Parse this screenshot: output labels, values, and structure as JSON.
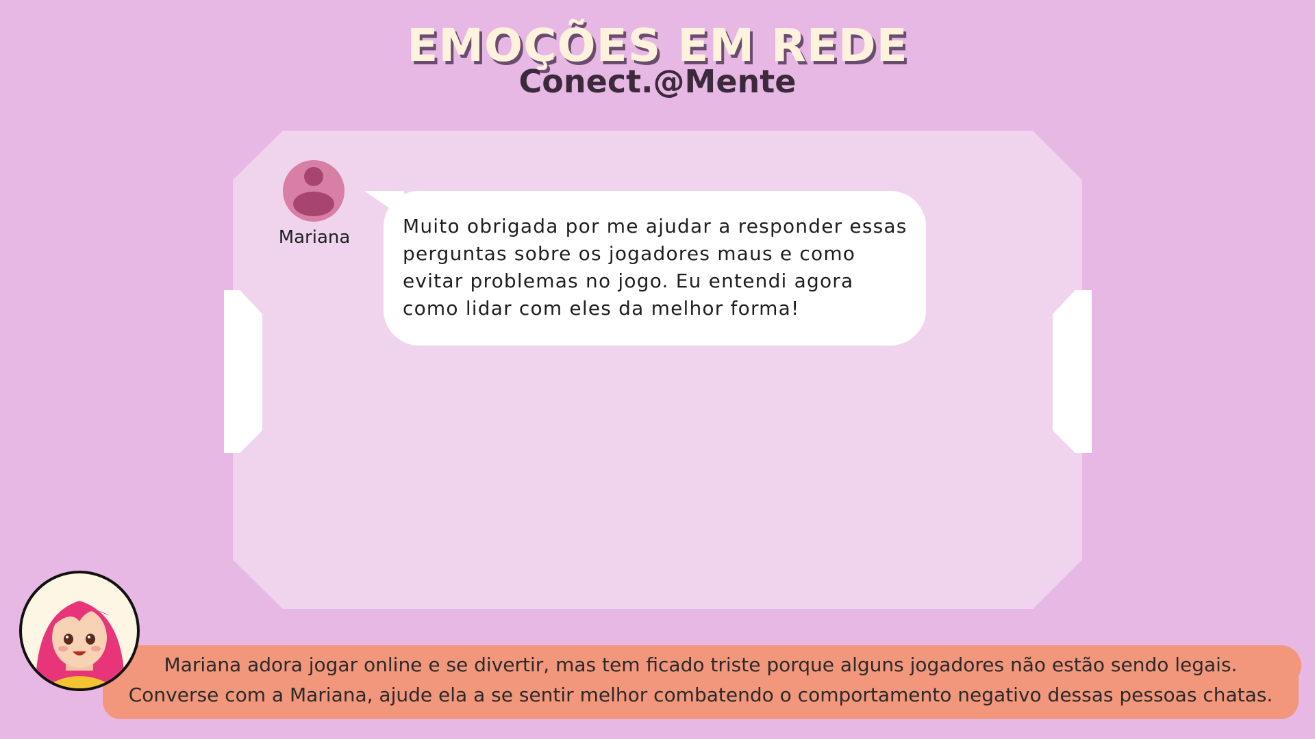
{
  "header": {
    "title": "EMOÇÕES EM REDE",
    "subtitle": "Conect.@Mente"
  },
  "chat": {
    "contact_name": "Mariana",
    "message": "Muito obrigada por me ajudar a responder essas perguntas sobre os jogadores maus e como evitar problemas no jogo. Eu entendi agora como lidar com eles da melhor forma!"
  },
  "info": {
    "line1": "Mariana adora jogar online e se divertir, mas tem ficado triste porque alguns jogadores não estão sendo legais.",
    "line2": "Converse com a Mariana, ajude ela a se sentir melhor combatendo o comportamento negativo dessas pessoas chatas."
  },
  "icons": {
    "contact_avatar": "user-silhouette-icon",
    "character": "mariana-character-illustration"
  },
  "colors": {
    "background": "#e8b8e4",
    "panel": "#f0d4ee",
    "title": "#fdf2dc",
    "info_box": "#f2967c"
  }
}
